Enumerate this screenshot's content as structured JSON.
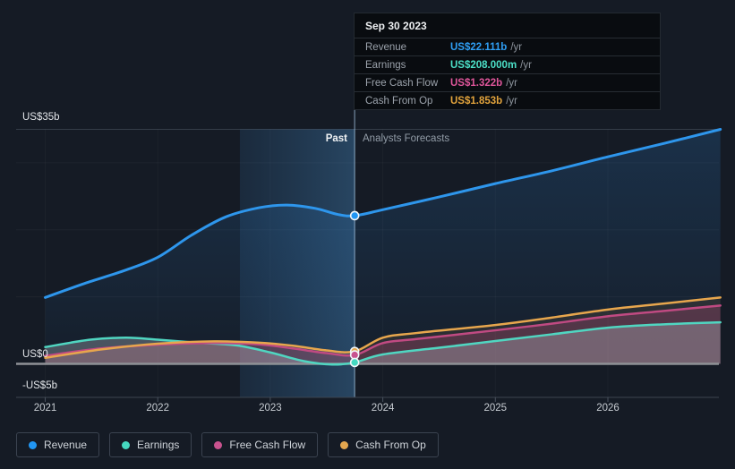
{
  "header": {
    "past_label": "Past",
    "forecast_label": "Analysts Forecasts"
  },
  "tooltip": {
    "date": "Sep 30 2023",
    "rows": [
      {
        "series": "revenue",
        "label": "Revenue",
        "value": "US$22.111b",
        "suffix": "/yr"
      },
      {
        "series": "earnings",
        "label": "Earnings",
        "value": "US$208.000m",
        "suffix": "/yr"
      },
      {
        "series": "fcf",
        "label": "Free Cash Flow",
        "value": "US$1.322b",
        "suffix": "/yr"
      },
      {
        "series": "cashop",
        "label": "Cash From Op",
        "value": "US$1.853b",
        "suffix": "/yr"
      }
    ]
  },
  "y_axis": {
    "top_label": "US$35b",
    "zero_label": "US$0",
    "bottom_label": "-US$5b"
  },
  "x_axis": {
    "years": [
      "2021",
      "2022",
      "2023",
      "2024",
      "2025",
      "2026"
    ]
  },
  "legend": [
    {
      "series": "revenue",
      "label": "Revenue"
    },
    {
      "series": "earnings",
      "label": "Earnings"
    },
    {
      "series": "fcf",
      "label": "Free Cash Flow"
    },
    {
      "series": "cashop",
      "label": "Cash From Op"
    }
  ],
  "colors": {
    "revenue": {
      "line": "#2e96ec",
      "accent": "#2f9ff5",
      "dot": "#2196f3",
      "fill": "rgba(45,125,200,0.16)"
    },
    "earnings": {
      "line": "#50d6c1",
      "accent": "#4ce0c8",
      "dot": "#45d8c0",
      "fill": "rgba(195,205,214,0.30)"
    },
    "fcf": {
      "line": "#c04a82",
      "accent": "#e0569b",
      "dot": "#c9538f",
      "fill": "rgba(198,74,133,0.25)"
    },
    "cashop": {
      "line": "#e7a64d",
      "accent": "#e2a33c",
      "dot": "#e4a74f",
      "fill": "rgba(231,166,77,0.10)"
    }
  },
  "chart_data": {
    "type": "line",
    "x_unit": "fiscal_year",
    "x_range": [
      2021,
      2027
    ],
    "y_unit": "US$ billions",
    "y_range": [
      -5,
      35
    ],
    "y_gridlines": [
      35,
      30,
      20,
      10,
      0,
      -5
    ],
    "grid": true,
    "legend_position": "bottom",
    "divider_x": 2023.75,
    "divider_date": "Sep 30 2023",
    "highlight_band_x": [
      2022.73,
      2023.75
    ],
    "marker_values": {
      "revenue": 22.111,
      "earnings": 0.208,
      "fcf": 1.322,
      "cashop": 1.853
    },
    "series": [
      {
        "id": "revenue",
        "name": "Revenue",
        "points": [
          [
            2021,
            9.9
          ],
          [
            2021.35,
            12.0
          ],
          [
            2021.7,
            13.9
          ],
          [
            2022,
            15.9
          ],
          [
            2022.3,
            19.2
          ],
          [
            2022.6,
            21.9
          ],
          [
            2022.9,
            23.3
          ],
          [
            2023.15,
            23.7
          ],
          [
            2023.4,
            23.2
          ],
          [
            2023.6,
            22.3
          ],
          [
            2023.75,
            22.111
          ],
          [
            2024,
            23.0
          ],
          [
            2024.5,
            24.9
          ],
          [
            2025,
            26.9
          ],
          [
            2025.5,
            28.8
          ],
          [
            2026,
            30.9
          ],
          [
            2026.5,
            32.9
          ],
          [
            2027,
            35.0
          ]
        ]
      },
      {
        "id": "earnings",
        "name": "Earnings",
        "points": [
          [
            2021,
            2.5
          ],
          [
            2021.4,
            3.6
          ],
          [
            2021.72,
            3.9
          ],
          [
            2022,
            3.6
          ],
          [
            2022.35,
            3.15
          ],
          [
            2022.7,
            2.75
          ],
          [
            2023,
            1.7
          ],
          [
            2023.3,
            0.4
          ],
          [
            2023.55,
            -0.1
          ],
          [
            2023.75,
            0.208
          ],
          [
            2024,
            1.4
          ],
          [
            2024.5,
            2.4
          ],
          [
            2025,
            3.4
          ],
          [
            2025.5,
            4.4
          ],
          [
            2026,
            5.4
          ],
          [
            2026.5,
            5.9
          ],
          [
            2027,
            6.2
          ]
        ]
      },
      {
        "id": "fcf",
        "name": "Free Cash Flow",
        "points": [
          [
            2021,
            1.2
          ],
          [
            2021.5,
            2.3
          ],
          [
            2022,
            2.85
          ],
          [
            2022.5,
            3.1
          ],
          [
            2022.9,
            2.9
          ],
          [
            2023.2,
            2.3
          ],
          [
            2023.5,
            1.6
          ],
          [
            2023.75,
            1.322
          ],
          [
            2024,
            3.1
          ],
          [
            2024.3,
            3.7
          ],
          [
            2025,
            5.0
          ],
          [
            2025.5,
            6.0
          ],
          [
            2026,
            7.1
          ],
          [
            2026.5,
            7.9
          ],
          [
            2027,
            8.7
          ]
        ]
      },
      {
        "id": "cashop",
        "name": "Cash From Op",
        "points": [
          [
            2021,
            0.9
          ],
          [
            2021.5,
            2.15
          ],
          [
            2022,
            3.0
          ],
          [
            2022.5,
            3.35
          ],
          [
            2022.9,
            3.15
          ],
          [
            2023.2,
            2.7
          ],
          [
            2023.5,
            2.0
          ],
          [
            2023.75,
            1.853
          ],
          [
            2024,
            3.9
          ],
          [
            2024.3,
            4.6
          ],
          [
            2025,
            5.8
          ],
          [
            2025.5,
            6.9
          ],
          [
            2026,
            8.1
          ],
          [
            2026.5,
            9.0
          ],
          [
            2027,
            9.9
          ]
        ]
      }
    ]
  }
}
